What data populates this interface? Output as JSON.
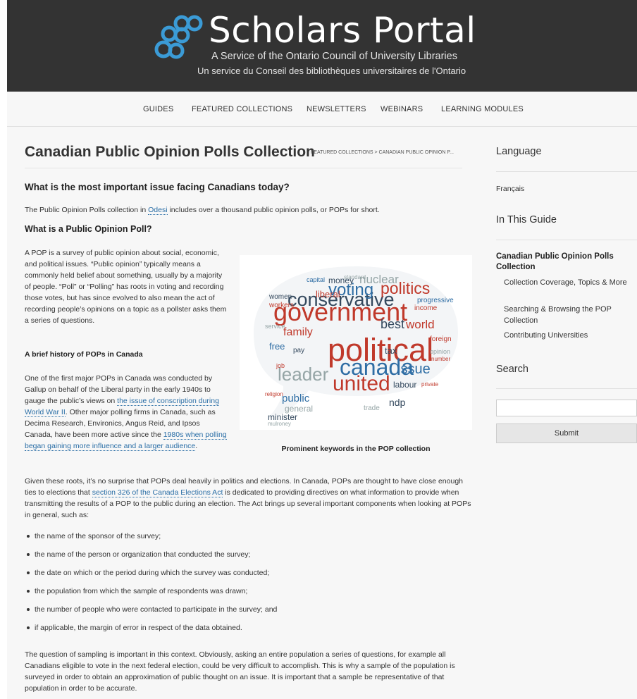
{
  "header": {
    "logo_title": "Scholars Portal",
    "logo_subtitle_en": "A Service of the Ontario Council of University Libraries",
    "logo_subtitle_fr": "Un service du Conseil des bibliothèques universitaires de l'Ontario"
  },
  "nav": {
    "items": [
      "GUIDES",
      "FEATURED COLLECTIONS",
      "NEWSLETTERS",
      "WEBINARS",
      "LEARNING MODULES"
    ]
  },
  "main": {
    "title": "Canadian Public Opinion Polls Collection",
    "breadcrumb": "FEATURED COLLECTIONS > CANADIAN PUBLIC OPINION P...",
    "heading_question": "What is the most important issue facing Canadians today?",
    "intro": {
      "before": "The Public Opinion Polls collection in ",
      "link": "Odesi",
      "after": " includes over a thousand public opinion polls, or POPs for short."
    },
    "heading_what": "What is a Public Opinion Poll?",
    "para_what": "A POP is a survey of public opinion about social, economic, and political issues. “Public opinion” typically means a commonly held belief about something, usually by a majority of people. “Poll” or “Polling” has roots in voting and recording those votes, but has since evolved to also mean the act of recording people’s opinions on a topic as a pollster asks them a series of questions.",
    "heading_history": "A brief history of POPs in Canada",
    "history": {
      "t1": "One of the first major POPs in Canada was conducted by Gallup on behalf of the Liberal party in the early 1940s to gauge the public’s views on ",
      "link1": "the issue of conscription during World War II",
      "t2": ". Other major polling firms in Canada, such as Decima Research, Environics, Angus Reid, and Ipsos Canada, have been more active since the ",
      "link2": "1980s when polling began gaining more influence and a larger audience",
      "t3": "."
    },
    "image_caption": "Prominent keywords in the POP collection",
    "roots": {
      "t1": "Given these roots, it’s no surprise that POPs deal heavily in politics and elections. In Canada, POPs are thought to have close enough ties to elections that ",
      "link": "section 326 of the Canada Elections Act",
      "t2": " is dedicated to providing directives on what information to provide when transmitting the results of a POP to the public during an election. The Act brings up several important components when looking at POPs in general, such as:"
    },
    "bullets": [
      "the name of the sponsor of the survey;",
      "the name of the person or organization that conducted the survey;",
      "the date on which or the period during which the survey was conducted;",
      "the population from which the sample of respondents was drawn;",
      "the number of people who were contacted to participate in the survey; and",
      "if applicable, the margin of error in respect of the data obtained."
    ],
    "sampling": "The question of sampling is important in this context. Obviously, asking an entire population a series of questions, for example all Canadians eligible to vote in the next federal election, could be very difficult to accomplish. This is why a sample of the population is surveyed in order to obtain an approximation of public thought on an issue. It is important that a sample be representative of that population in order to be accurate."
  },
  "wordcloud": {
    "words": [
      "political",
      "government",
      "conservative",
      "voting",
      "politics",
      "canada",
      "united",
      "leader",
      "issue",
      "best",
      "world",
      "nuclear",
      "family",
      "public",
      "general",
      "minister",
      "mulroney",
      "trade",
      "liberal",
      "tax",
      "free",
      "money",
      "women",
      "workers",
      "income",
      "progressive",
      "labour",
      "pay",
      "ndp",
      "job",
      "foreign",
      "standard",
      "opinion",
      "religion",
      "service",
      "number",
      "capital",
      "private"
    ],
    "colors": [
      "#c0392b",
      "#34495e",
      "#2e6da4",
      "#95a5a6"
    ]
  },
  "sidebar": {
    "language_heading": "Language",
    "language_link": "Français",
    "guide_heading": "In This Guide",
    "guide_title": "Canadian Public Opinion Polls Collection",
    "guide_items": [
      "Collection Coverage, Topics & More",
      "Searching & Browsing the POP Collection",
      "Contributing Universities"
    ],
    "search_heading": "Search",
    "search_placeholder": "",
    "submit_label": "Submit"
  }
}
